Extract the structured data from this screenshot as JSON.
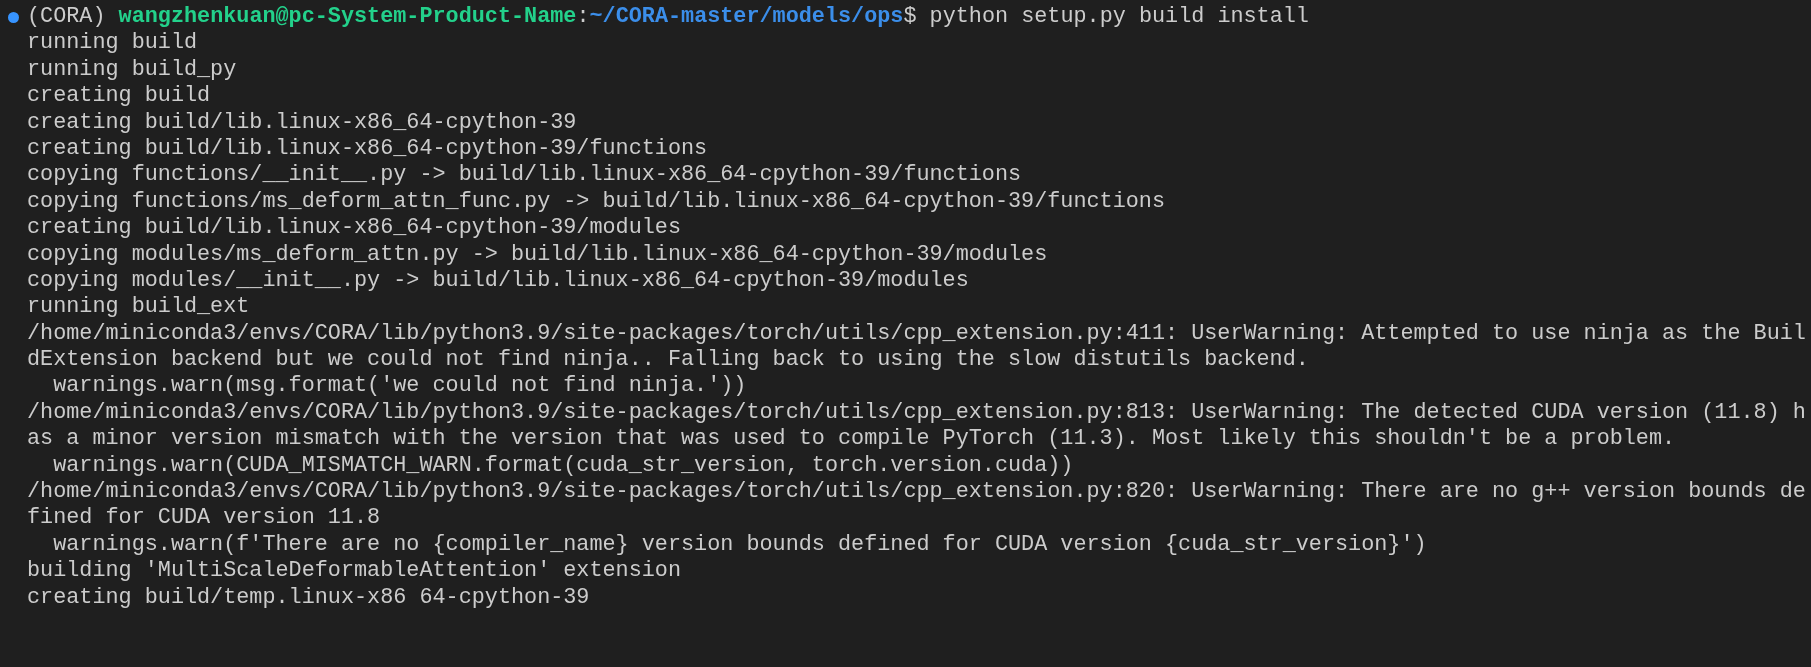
{
  "prompt": {
    "env": "(CORA)",
    "user_host": "wangzhenkuan@pc-System-Product-Name",
    "separator": ":",
    "path": "~/CORA-master/models/ops",
    "symbol": "$",
    "command": "python setup.py build install"
  },
  "output": [
    "running build",
    "running build_py",
    "creating build",
    "creating build/lib.linux-x86_64-cpython-39",
    "creating build/lib.linux-x86_64-cpython-39/functions",
    "copying functions/__init__.py -> build/lib.linux-x86_64-cpython-39/functions",
    "copying functions/ms_deform_attn_func.py -> build/lib.linux-x86_64-cpython-39/functions",
    "creating build/lib.linux-x86_64-cpython-39/modules",
    "copying modules/ms_deform_attn.py -> build/lib.linux-x86_64-cpython-39/modules",
    "copying modules/__init__.py -> build/lib.linux-x86_64-cpython-39/modules",
    "running build_ext",
    "/home/miniconda3/envs/CORA/lib/python3.9/site-packages/torch/utils/cpp_extension.py:411: UserWarning: Attempted to use ninja as the Buil",
    "dExtension backend but we could not find ninja.. Falling back to using the slow distutils backend.",
    "  warnings.warn(msg.format('we could not find ninja.'))",
    "/home/miniconda3/envs/CORA/lib/python3.9/site-packages/torch/utils/cpp_extension.py:813: UserWarning: The detected CUDA version (11.8) h",
    "as a minor version mismatch with the version that was used to compile PyTorch (11.3). Most likely this shouldn't be a problem.",
    "  warnings.warn(CUDA_MISMATCH_WARN.format(cuda_str_version, torch.version.cuda))",
    "/home/miniconda3/envs/CORA/lib/python3.9/site-packages/torch/utils/cpp_extension.py:820: UserWarning: There are no g++ version bounds de",
    "fined for CUDA version 11.8",
    "  warnings.warn(f'There are no {compiler_name} version bounds defined for CUDA version {cuda_str_version}')",
    "building 'MultiScaleDeformableAttention' extension",
    "creating build/temp.linux-x86 64-cpython-39"
  ]
}
